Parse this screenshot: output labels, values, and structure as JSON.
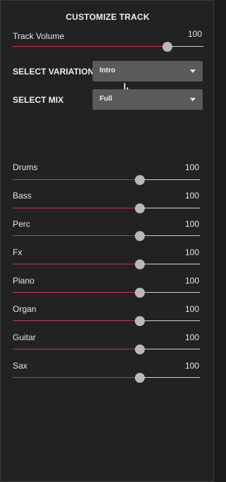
{
  "header": {
    "title": "CUSTOMIZE TRACK"
  },
  "track_volume": {
    "label": "Track Volume",
    "value": "100",
    "level": 0.81
  },
  "variation": {
    "label": "SELECT VARIATION",
    "selected": "Intro"
  },
  "mix": {
    "label": "SELECT MIX",
    "selected": "Full"
  },
  "instruments": [
    {
      "label": "Drums",
      "value": "100",
      "level": 0.68
    },
    {
      "label": "Bass",
      "value": "100",
      "level": 0.68
    },
    {
      "label": "Perc",
      "value": "100",
      "level": 0.68
    },
    {
      "label": "Fx",
      "value": "100",
      "level": 0.68
    },
    {
      "label": "Piano",
      "value": "100",
      "level": 0.68
    },
    {
      "label": "Organ",
      "value": "100",
      "level": 0.68
    },
    {
      "label": "Guitar",
      "value": "100",
      "level": 0.68
    },
    {
      "label": "Sax",
      "value": "100",
      "level": 0.68
    }
  ],
  "colors": {
    "accent": "#c8324e",
    "track": "#cfcfcf",
    "thumb": "#b9b9b9",
    "select_bg": "#5a5a5a",
    "panel_bg": "#222222"
  },
  "icons": {
    "dropdown": "caret-down-icon",
    "pointer": "hand-pointer-icon"
  }
}
